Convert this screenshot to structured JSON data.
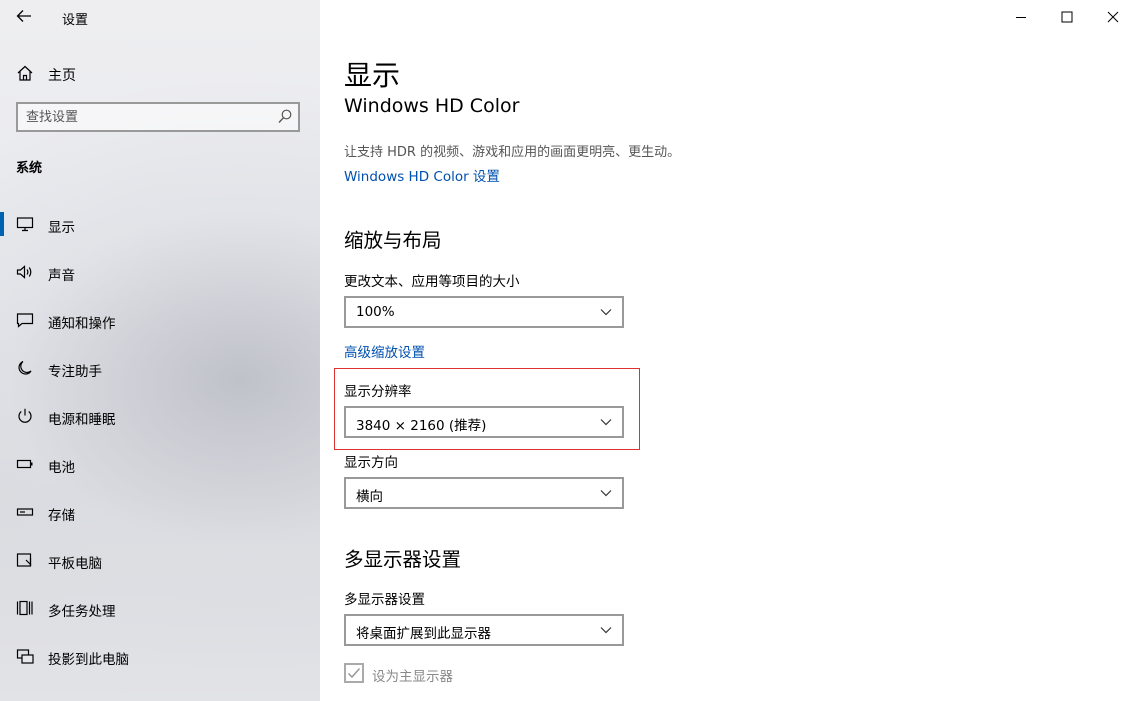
{
  "window": {
    "title": "设置"
  },
  "sidebar": {
    "home_label": "主页",
    "search_placeholder": "查找设置",
    "section_title": "系统",
    "items": [
      {
        "label": "显示",
        "icon": "monitor-icon",
        "active": true
      },
      {
        "label": "声音",
        "icon": "speaker-icon"
      },
      {
        "label": "通知和操作",
        "icon": "notification-icon"
      },
      {
        "label": "专注助手",
        "icon": "moon-icon"
      },
      {
        "label": "电源和睡眠",
        "icon": "power-icon"
      },
      {
        "label": "电池",
        "icon": "battery-icon"
      },
      {
        "label": "存储",
        "icon": "storage-icon"
      },
      {
        "label": "平板电脑",
        "icon": "tablet-icon"
      },
      {
        "label": "多任务处理",
        "icon": "multitask-icon"
      },
      {
        "label": "投影到此电脑",
        "icon": "project-icon"
      }
    ]
  },
  "main": {
    "page_title": "显示",
    "hdr": {
      "heading": "Windows HD Color",
      "description": "让支持 HDR 的视频、游戏和应用的画面更明亮、更生动。",
      "link": "Windows HD Color 设置"
    },
    "scale_layout": {
      "heading": "缩放与布局",
      "text_size_label": "更改文本、应用等项目的大小",
      "text_size_value": "100%",
      "advanced_link": "高级缩放设置",
      "resolution_label": "显示分辨率",
      "resolution_value": "3840 × 2160 (推荐)",
      "orientation_label": "显示方向",
      "orientation_value": "横向"
    },
    "multi_display": {
      "heading": "多显示器设置",
      "label": "多显示器设置",
      "value": "将桌面扩展到此显示器",
      "primary_checkbox_label": "设为主显示器",
      "primary_checked": true
    }
  },
  "colors": {
    "accent": "#0063b1",
    "link": "#0050b0",
    "highlight": "#e03030"
  }
}
